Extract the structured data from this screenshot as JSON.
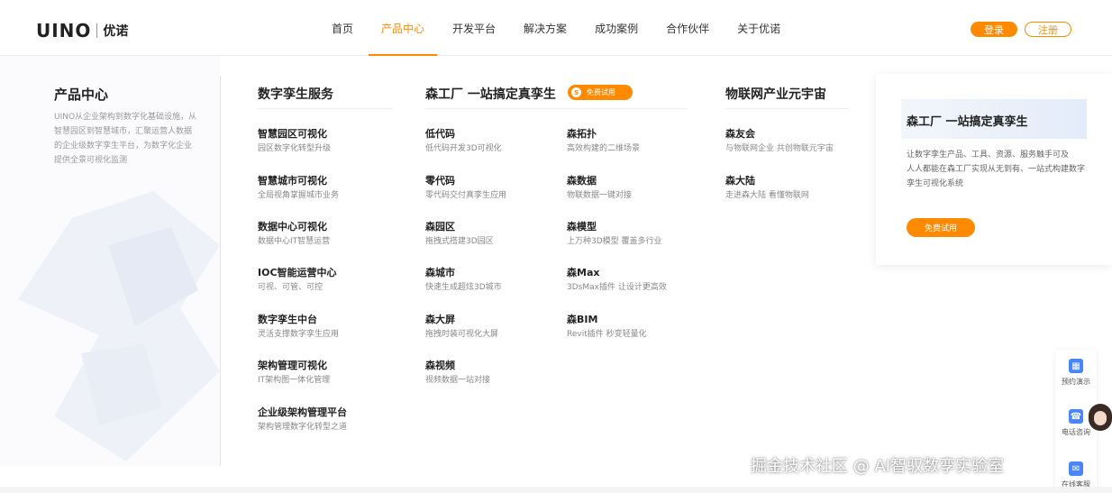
{
  "header": {
    "logo_text": "UINO",
    "logo_cn": "优诺",
    "nav": [
      {
        "label": "首页",
        "active": false
      },
      {
        "label": "产品中心",
        "active": true
      },
      {
        "label": "开发平台",
        "active": false
      },
      {
        "label": "解决方案",
        "active": false
      },
      {
        "label": "成功案例",
        "active": false
      },
      {
        "label": "合作伙伴",
        "active": false
      },
      {
        "label": "关于优诺",
        "active": false
      }
    ],
    "login_label": "登录",
    "register_label": "注册"
  },
  "intro": {
    "title": "产品中心",
    "description": "UINO从企业架构到数字化基础设施，从智慧园区到智慧城市，汇聚运营人数据的企业级数字孪生平台，为数字化企业提供全景可视化监测"
  },
  "columns": {
    "twin_services": {
      "heading": "数字孪生服务",
      "items": [
        {
          "title": "智慧园区可视化",
          "sub": "园区数字化转型升级"
        },
        {
          "title": "智慧城市可视化",
          "sub": "全局视角掌握城市业务"
        },
        {
          "title": "数据中心可视化",
          "sub": "数据中心IT智慧运营"
        },
        {
          "title": "IOC智能运营中心",
          "sub": "可视、可管、可控"
        },
        {
          "title": "数字孪生中台",
          "sub": "灵活支撑数字孪生应用"
        },
        {
          "title": "架构管理可视化",
          "sub": "IT架构图一体化管理"
        },
        {
          "title": "企业级架构管理平台",
          "sub": "架构管理数字化转型之道"
        }
      ]
    },
    "factory": {
      "heading": "森工厂 一站搞定真孪生",
      "badge_icon": "S",
      "badge_label": "免费试用",
      "left_items": [
        {
          "title": "低代码",
          "sub": "低代码开发3D可视化"
        },
        {
          "title": "零代码",
          "sub": "零代码交付真孪生应用"
        },
        {
          "title": "森园区",
          "sub": "拖拽式搭建3D园区"
        },
        {
          "title": "森城市",
          "sub": "快速生成超炫3D城市"
        },
        {
          "title": "森大屏",
          "sub": "拖拽时装可视化大屏"
        },
        {
          "title": "森视频",
          "sub": "视频数据一站对接"
        }
      ],
      "right_items": [
        {
          "title": "森拓扑",
          "sub": "高效构建的二维场景"
        },
        {
          "title": "森数据",
          "sub": "物联数据一键对接"
        },
        {
          "title": "森模型",
          "sub": "上万种3D模型 覆盖多行业"
        },
        {
          "title": "森Max",
          "sub": "3DsMax插件 让设计更高效"
        },
        {
          "title": "森BIM",
          "sub": "Revit插件 秒变轻量化"
        }
      ]
    },
    "iot": {
      "heading": "物联网产业元宇宙",
      "items": [
        {
          "title": "森友会",
          "sub": "与物联网企业 共创物联元宇宙"
        },
        {
          "title": "森大陆",
          "sub": "走进森大陆 看懂物联网"
        }
      ]
    }
  },
  "promo": {
    "title": "森工厂 一站搞定真孪生",
    "line1": "让数字孪生产品、工具、资源、服务触手可及",
    "line2": "人人都能在森工厂实现从无到有、一站式构建数字孪生可视化系统",
    "button_label": "免费试用"
  },
  "floating": {
    "items": [
      {
        "label": "预约演示",
        "icon": "calendar-icon"
      },
      {
        "label": "电话咨询",
        "icon": "phone-icon"
      },
      {
        "label": "在线客服",
        "icon": "chat-icon"
      }
    ]
  },
  "watermark": "掘金技术社区 @ AI智驭数孪实验室",
  "colors": {
    "accent": "#ff8a00",
    "text": "#222222",
    "muted": "#888888"
  }
}
